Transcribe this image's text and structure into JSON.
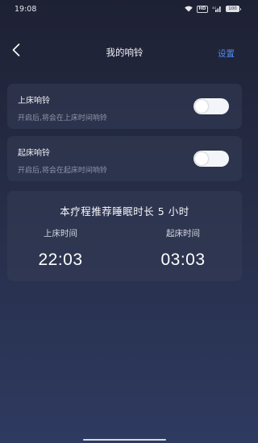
{
  "status_bar": {
    "time": "19:08",
    "hd_label": "HD",
    "network_label": "4G",
    "battery_level": "100"
  },
  "header": {
    "title": "我的响铃",
    "settings_label": "设置"
  },
  "bedtime_alarm": {
    "title": "上床响铃",
    "description": "开启后,将会在上床时间响铃",
    "enabled": false
  },
  "wake_alarm": {
    "title": "起床响铃",
    "description": "开启后,将会在起床时间响铃",
    "enabled": false
  },
  "summary": {
    "recommendation": "本疗程推荐睡眠时长 5 小时",
    "bedtime_label": "上床时间",
    "bedtime_value": "22:03",
    "wake_label": "起床时间",
    "wake_value": "03:03"
  },
  "colors": {
    "accent": "#4d8ef3",
    "card": "#343c56",
    "background_top": "#1e2134",
    "background_bottom": "#2e3a60"
  }
}
